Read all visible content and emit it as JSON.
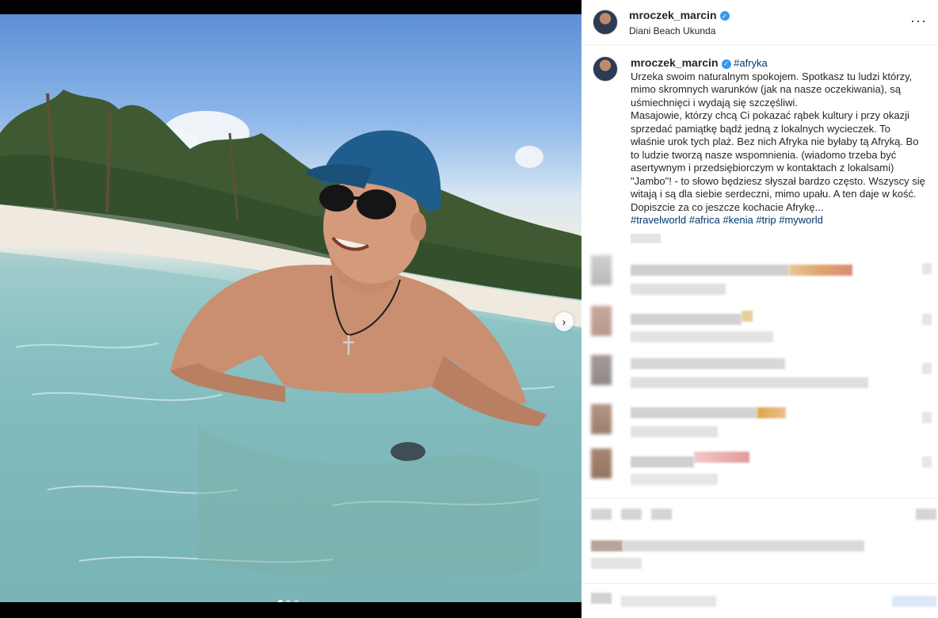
{
  "post": {
    "username": "mroczek_marcin",
    "location": "Diani Beach Ukunda",
    "more_icon": "more-icon",
    "verified_icon": "verified-badge-icon"
  },
  "caption": {
    "username": "mroczek_marcin",
    "first_tag": "#afryka",
    "paragraph1": "Urzeka swoim naturalnym spokojem. Spotkasz tu ludzi którzy, mimo skromnych warunków (jak na nasze oczekiwania), są uśmiechnięci i wydają się szczęśliwi.",
    "paragraph2": "Masajowie, którzy chcą Ci pokazać rąbek kultury i przy okazji sprzedać pamiątkę bądź jedną z lokalnych wycieczek. To właśnie urok tych plaż. Bez nich Afryka nie byłaby tą Afryką. Bo to ludzie tworzą nasze wspomnienia. (wiadomo trzeba być asertywnym i przedsiębiorczym w kontaktach z lokalsami)",
    "paragraph3": "\"Jambo\"! - to słowo będziesz słyszał bardzo często. Wszyscy się witają i są dla siebie serdeczni, mimo upału. A ten daje w kość. Dopiszcie za co jeszcze kochacie Afrykę...",
    "hashtags": [
      "#travelworld",
      "#africa",
      "#kenia",
      "#trip",
      "#myworld"
    ]
  },
  "carousel": {
    "slide_count": 3,
    "active_index": 0,
    "next_icon": "chevron-right-icon"
  },
  "colors": {
    "link": "#00376b",
    "verified": "#3897f0",
    "blur_gray": "#dcdcdc"
  }
}
